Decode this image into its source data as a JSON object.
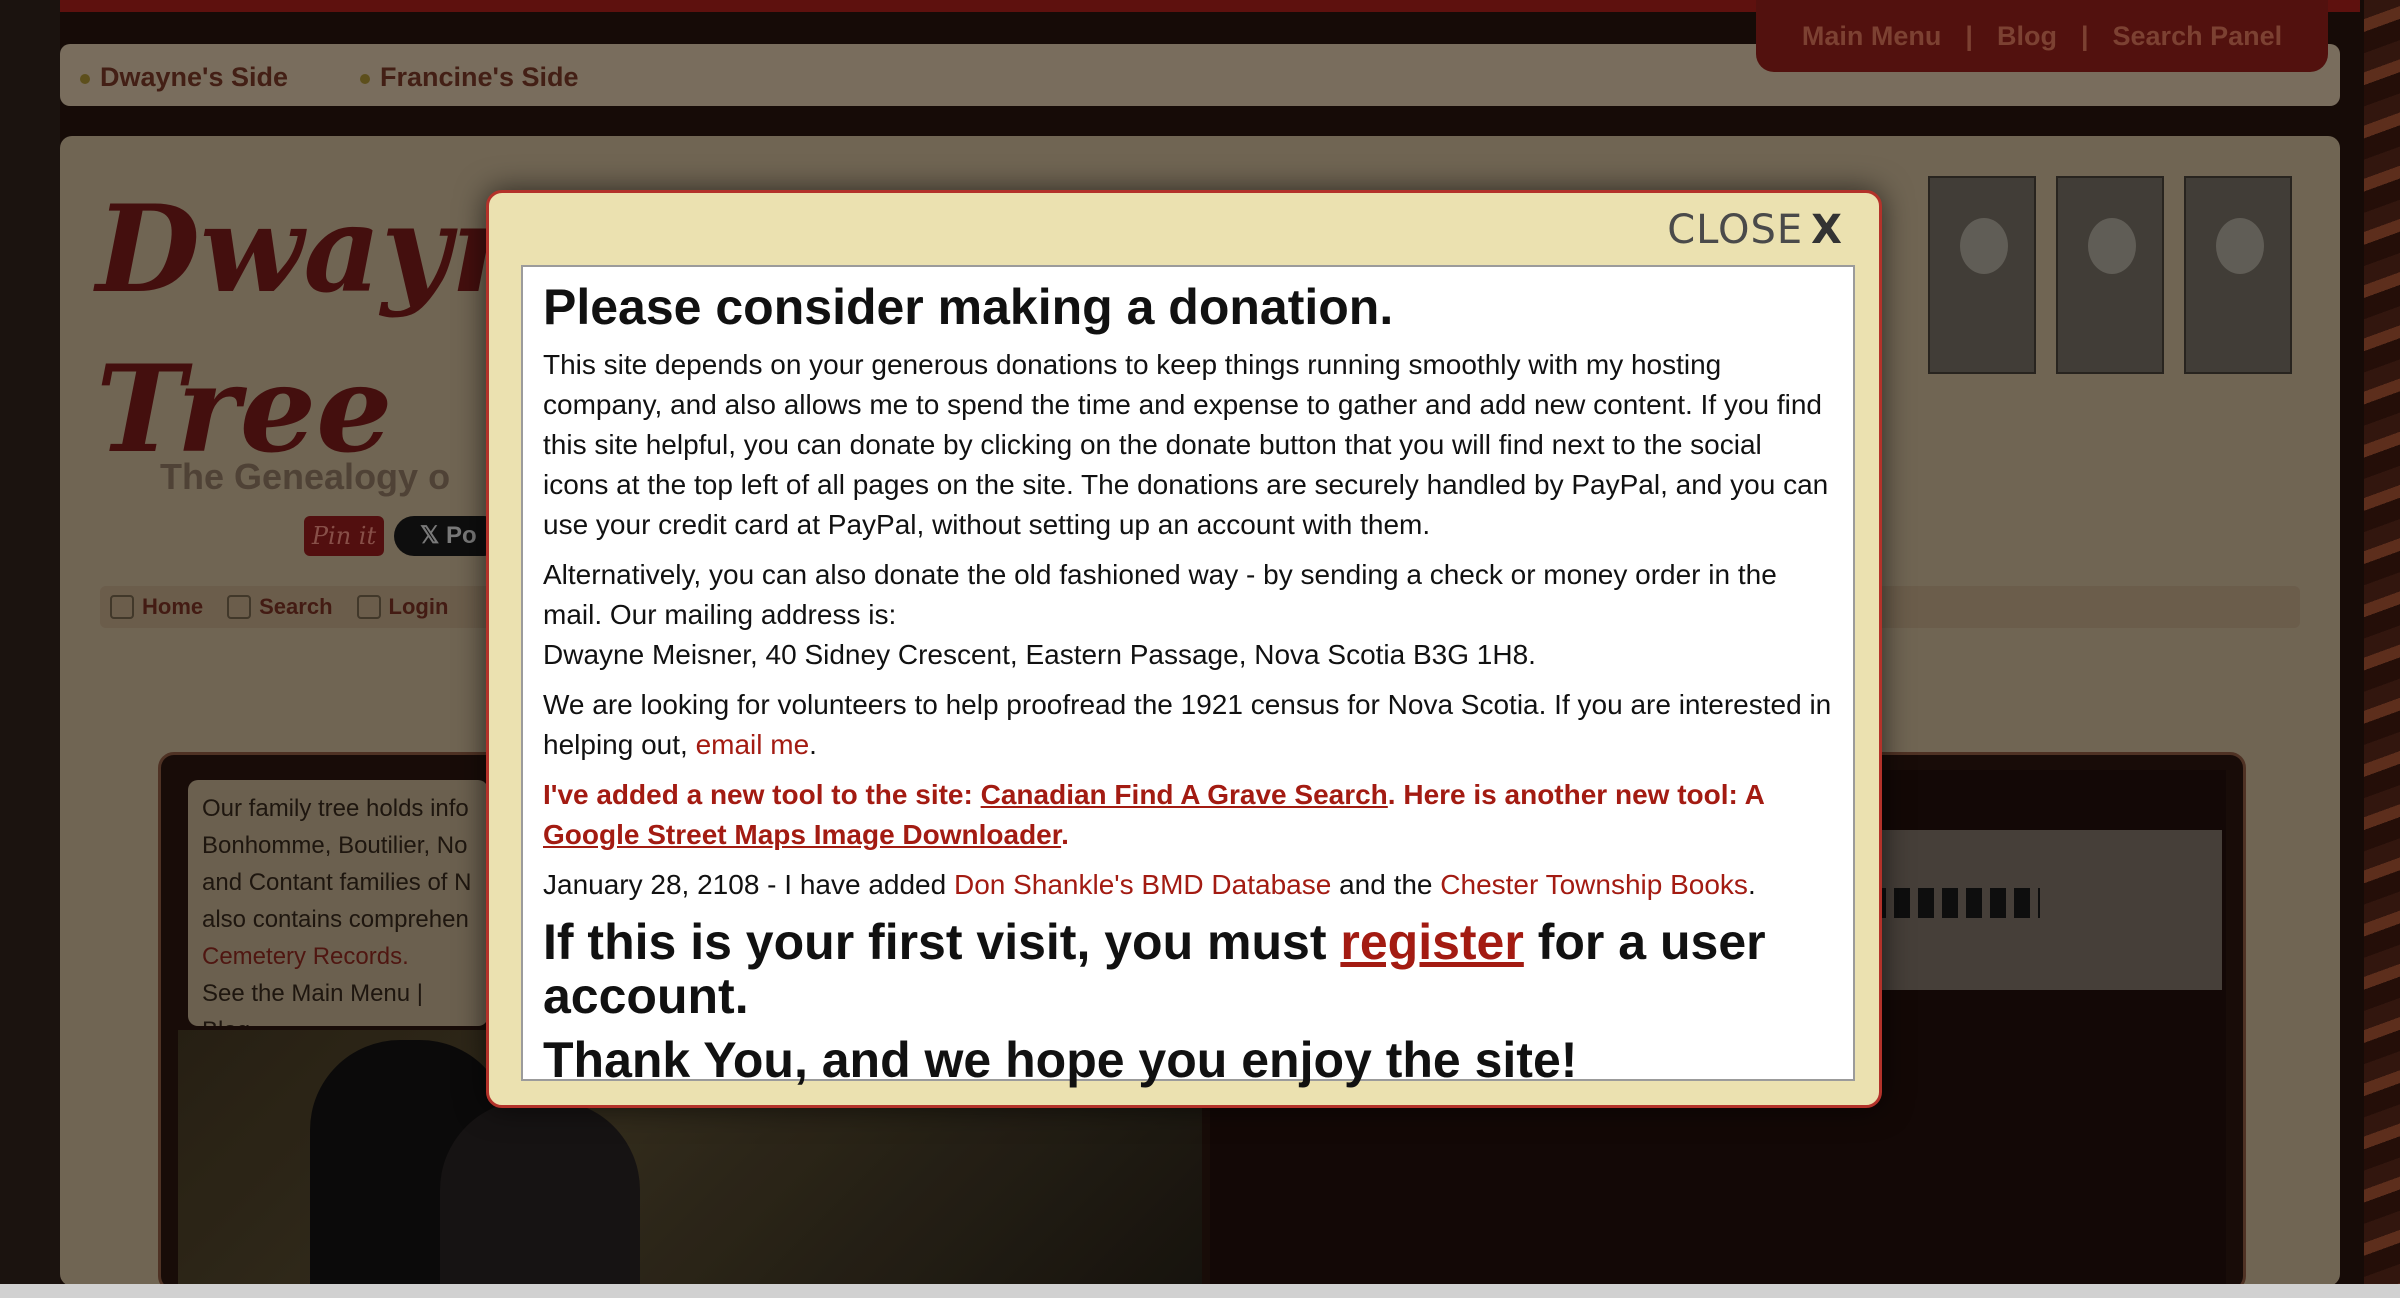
{
  "top_nav": {
    "tabs": [
      "Dwayne's Side",
      "Francine's Side"
    ],
    "menu": [
      "Main Menu",
      "Blog",
      "Search Panel"
    ],
    "separator": "|"
  },
  "site": {
    "title_line1": "Dwayne",
    "title_line2": "Tree",
    "subtitle": "The Genealogy o",
    "pin_label": "Pin it",
    "x_label": "Po"
  },
  "sub_nav": [
    {
      "label": "Home",
      "icon": "home-icon"
    },
    {
      "label": "Search",
      "icon": "search-icon"
    },
    {
      "label": "Login",
      "icon": "lock-icon"
    }
  ],
  "info_box": {
    "lines": [
      "Our family tree holds info",
      "Bonhomme, Boutilier, No",
      "and Contant families of N",
      "also contains comprehen"
    ],
    "link": "Cemetery Records.",
    "footer": "See the Main Menu | Blog"
  },
  "modal": {
    "close_label": "CLOSE",
    "close_x": "X",
    "title": "Please consider making a donation.",
    "para1": "This site depends on your generous donations to keep things running smoothly with my hosting company, and also allows me to spend the time and expense to gather and add new content. If you find this site helpful, you can donate by clicking on the donate button that you will find next to the social icons at the top left of all pages on the site. The donations are securely handled by PayPal, and you can use your credit card at PayPal, without setting up an account with them.",
    "para2_a": "Alternatively, you can also donate the old fashioned way - by sending a check or money order in the mail. Our mailing address is:",
    "para2_b": "Dwayne Meisner, 40 Sidney Crescent, Eastern Passage, Nova Scotia B3G 1H8.",
    "para3_text": "We are looking for volunteers to help proofread the 1921 census for Nova Scotia. If you are interested in helping out,",
    "para3_link": "email me",
    "para3_end": ".",
    "tools_intro": "I've added a new tool to the site:",
    "tool1_link": "Canadian Find A Grave Search",
    "tools_mid": ". Here is another new tool: A",
    "tool2_link": "Google Street Maps Image Downloader",
    "tools_end": ".",
    "news_date": "January 28, 2108 - I have added",
    "news_link1": "Don Shankle's BMD Database",
    "news_and": "and the",
    "news_link2": "Chester Township Books",
    "news_end": ".",
    "first_visit_a": "If this is your first visit, you must",
    "register_link": "register",
    "first_visit_b": "for a user account.",
    "thanks": "Thank You, and we hope you enjoy the site!"
  },
  "colors": {
    "accent_red": "#a31b12",
    "modal_bg": "#ebe1b0",
    "modal_border": "#b3322a"
  }
}
